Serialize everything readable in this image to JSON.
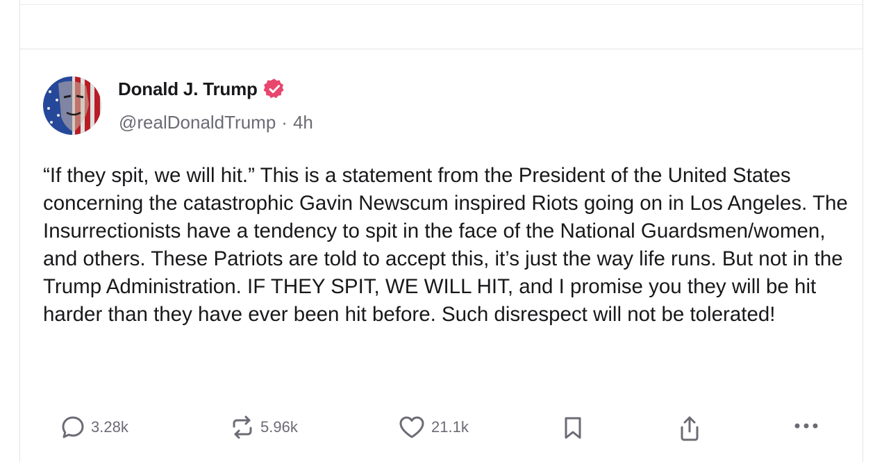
{
  "post": {
    "author_name": "Donald J. Trump",
    "handle": "@realDonaldTrump",
    "separator": "·",
    "time_ago": "4h",
    "text": "“If they spit, we will hit.” This is a statement from the President of the United States concerning the catastrophic Gavin Newscum inspired Riots going on in Los Angeles. The Insurrectionists have a tendency to spit in the face of the National Guardsmen/women, and others. These Patriots are told to accept this, it’s just the way life runs. But not in the Trump Administration. IF THEY SPIT, WE WILL HIT, and I promise you they will be hit harder than they have ever been hit before. Such disrespect will not be tolerated!"
  },
  "actions": {
    "replies": "3.28k",
    "reposts": "5.96k",
    "likes": "21.1k"
  },
  "icons": {
    "verified": "verified-badge-icon",
    "reply": "speech-bubble-icon",
    "repost": "repost-arrows-icon",
    "like": "heart-icon",
    "bookmark": "bookmark-icon",
    "share": "share-upload-icon",
    "more": "ellipsis-icon"
  },
  "colors": {
    "verified": "#e8466d",
    "text": "#18181b",
    "muted": "#6b6b75"
  }
}
